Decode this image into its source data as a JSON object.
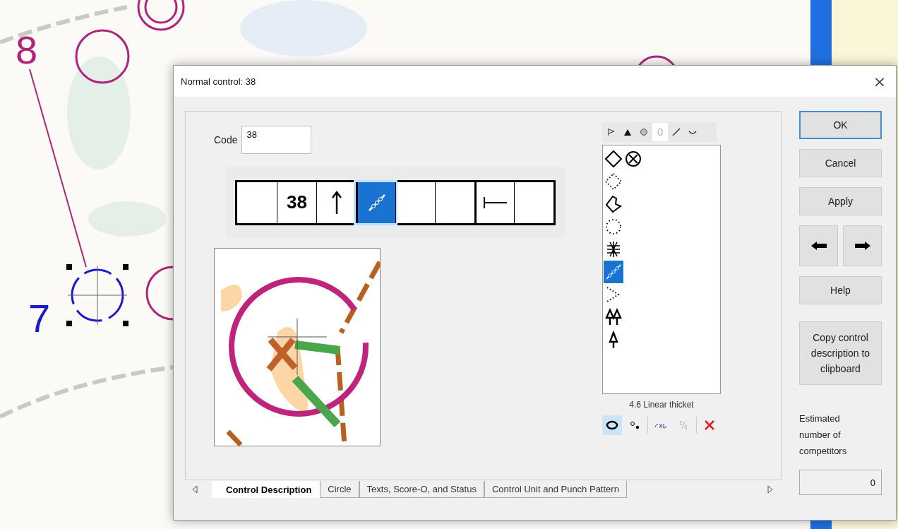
{
  "map": {
    "labels": [
      {
        "text": "8",
        "kind": "course"
      },
      {
        "text": "7",
        "kind": "selected"
      }
    ]
  },
  "window": {
    "title": "Normal control: 38",
    "close": "×"
  },
  "code": {
    "label": "Code",
    "value": "38"
  },
  "description": {
    "cells": [
      {
        "kind": "empty"
      },
      {
        "kind": "text",
        "text": "38",
        "selected": false
      },
      {
        "kind": "arrow",
        "selected": false
      },
      {
        "kind": "thicket",
        "selected": true
      },
      {
        "kind": "empty"
      },
      {
        "kind": "empty"
      },
      {
        "kind": "dimension",
        "selected": false
      },
      {
        "kind": "empty"
      }
    ]
  },
  "palette": {
    "tabs": [
      {
        "kind": "flag",
        "selected": false
      },
      {
        "kind": "triangle",
        "selected": false
      },
      {
        "kind": "blob",
        "selected": false
      },
      {
        "kind": "outline",
        "selected": true
      },
      {
        "kind": "line",
        "selected": false
      },
      {
        "kind": "curve",
        "selected": false
      }
    ],
    "rows": [
      [
        {
          "kind": "diamond",
          "selected": false
        },
        {
          "kind": "circle-x",
          "selected": false
        }
      ],
      [
        {
          "kind": "dotted-diamond",
          "selected": false
        }
      ],
      [
        {
          "kind": "boot",
          "selected": false
        }
      ],
      [
        {
          "kind": "dotted-circle",
          "selected": false
        }
      ],
      [
        {
          "kind": "hatch",
          "selected": false
        }
      ],
      [
        {
          "kind": "thicket",
          "selected": true
        }
      ],
      [
        {
          "kind": "dotted-v",
          "selected": false
        }
      ],
      [
        {
          "kind": "double-tree",
          "selected": false
        }
      ],
      [
        {
          "kind": "tree",
          "selected": false
        }
      ]
    ],
    "caption": "4.6 Linear thicket",
    "tools": [
      {
        "kind": "ellipse",
        "selected": true
      },
      {
        "kind": "dots",
        "selected": false
      },
      {
        "kind": "size",
        "selected": false
      },
      {
        "kind": "fraction",
        "selected": false
      },
      {
        "kind": "delete",
        "selected": false
      }
    ]
  },
  "tabs": [
    {
      "label": "Control Description",
      "selected": true
    },
    {
      "label": "Circle",
      "selected": false
    },
    {
      "label": "Texts, Score-O, and Status",
      "selected": false
    },
    {
      "label": "Control Unit and Punch Pattern",
      "selected": false
    }
  ],
  "buttons": {
    "ok": "OK",
    "cancel": "Cancel",
    "apply": "Apply",
    "help": "Help",
    "copy": "Copy control description to clipboard"
  },
  "competitors": {
    "label": "Estimated number of competitors",
    "value": "0"
  }
}
